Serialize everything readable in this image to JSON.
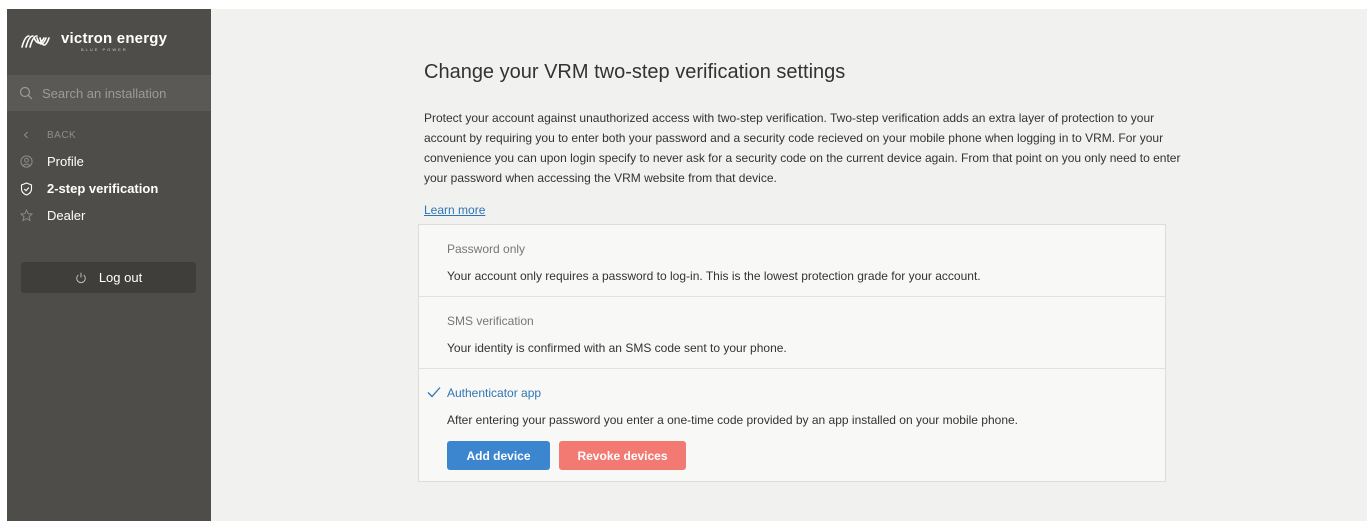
{
  "sidebar": {
    "brand_name": "victron energy",
    "brand_tagline": "BLUE POWER",
    "search_placeholder": "Search an installation",
    "back_label": "BACK",
    "items": [
      {
        "label": "Profile",
        "icon": "user-circle-icon"
      },
      {
        "label": "2-step verification",
        "icon": "shield-icon"
      },
      {
        "label": "Dealer",
        "icon": "star-icon"
      }
    ],
    "logout_label": "Log out"
  },
  "main": {
    "title": "Change your VRM two-step verification settings",
    "description": "Protect your account against unauthorized access with two-step verification. Two-step verification adds an extra layer of protection to your account by requiring you to enter both your password and a security code recieved on your mobile phone when logging in to VRM. For your convenience you can upon login specify to never ask for a security code on the current device again. From that point on you only need to enter your password when accessing the VRM website from that device.",
    "learn_more": "Learn more",
    "options": [
      {
        "label": "Password only",
        "text": "Your account only requires a password to log-in. This is the lowest protection grade for your account.",
        "selected": false
      },
      {
        "label": "SMS verification",
        "text": "Your identity is confirmed with an SMS code sent to your phone.",
        "selected": false
      },
      {
        "label": "Authenticator app",
        "text": "After entering your password you enter a one-time code provided by an app installed on your mobile phone.",
        "selected": true
      }
    ],
    "add_device_label": "Add device",
    "revoke_devices_label": "Revoke devices"
  },
  "colors": {
    "sidebar_bg": "#4e4d49",
    "accent_blue": "#3c86cf",
    "revoke_red": "#f27a73",
    "link_blue": "#2f75b5"
  }
}
